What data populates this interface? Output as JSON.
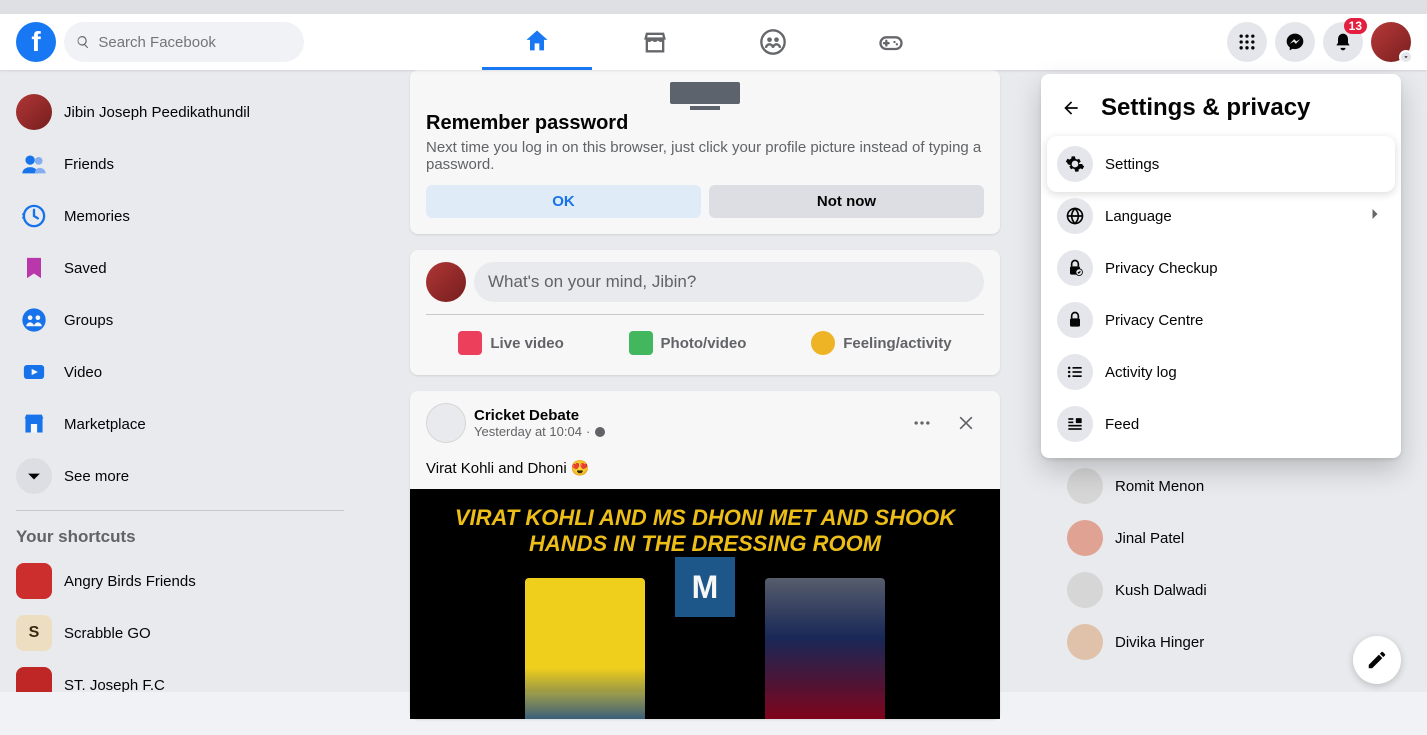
{
  "topnav": {
    "search_placeholder": "Search Facebook",
    "notification_count": "13"
  },
  "sidebar": {
    "items": [
      {
        "label": "Jibin Joseph Peedikathundil",
        "icon": "profile"
      },
      {
        "label": "Friends",
        "icon": "friends"
      },
      {
        "label": "Memories",
        "icon": "memories"
      },
      {
        "label": "Saved",
        "icon": "saved"
      },
      {
        "label": "Groups",
        "icon": "groups"
      },
      {
        "label": "Video",
        "icon": "video"
      },
      {
        "label": "Marketplace",
        "icon": "marketplace"
      },
      {
        "label": "See more",
        "icon": "more"
      }
    ],
    "shortcuts_title": "Your shortcuts",
    "shortcuts": [
      {
        "label": "Angry Birds Friends"
      },
      {
        "label": "Scrabble GO"
      },
      {
        "label": "ST. Joseph F.C"
      }
    ]
  },
  "remember": {
    "title": "Remember password",
    "subtitle": "Next time you log in on this browser, just click your profile picture instead of typing a password.",
    "ok": "OK",
    "notnow": "Not now"
  },
  "composer": {
    "placeholder": "What's on your mind, Jibin?",
    "live": "Live video",
    "photo": "Photo/video",
    "feeling": "Feeling/activity"
  },
  "post": {
    "author": "Cricket Debate",
    "time": "Yesterday at 10:04",
    "text": "Virat Kohli and Dhoni 😍",
    "image_title1": "VIRAT KOHLI AND MS DHONI MET AND SHOOK",
    "image_title2": "HANDS IN THE DRESSING ROOM"
  },
  "contacts": [
    {
      "name": "Romit Menon"
    },
    {
      "name": "Jinal Patel"
    },
    {
      "name": "Kush Dalwadi"
    },
    {
      "name": "Divika Hinger"
    }
  ],
  "settings": {
    "title": "Settings & privacy",
    "items": [
      {
        "label": "Settings",
        "icon": "gear",
        "highlighted": true
      },
      {
        "label": "Language",
        "icon": "globe",
        "chevron": true
      },
      {
        "label": "Privacy Checkup",
        "icon": "lockcheck"
      },
      {
        "label": "Privacy Centre",
        "icon": "lock"
      },
      {
        "label": "Activity log",
        "icon": "list"
      },
      {
        "label": "Feed",
        "icon": "feed"
      }
    ]
  }
}
